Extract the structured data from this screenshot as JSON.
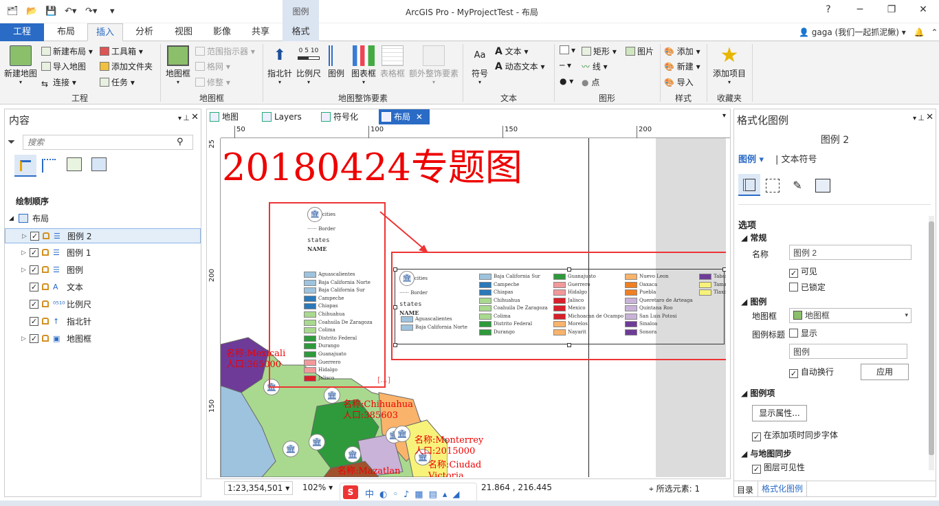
{
  "window": {
    "title": "ArcGIS Pro - MyProjectTest - 布局",
    "context_group": "图例",
    "help": "?",
    "user": "gaga (我们一起抓泥鳅)"
  },
  "tabs": [
    "工程",
    "布局",
    "插入",
    "分析",
    "视图",
    "影像",
    "共享",
    "格式"
  ],
  "ribbon": {
    "project": {
      "new_map": "新建地图",
      "new_layout": "新建布局",
      "import_map": "导入地图",
      "connect": "连接",
      "toolbox": "工具箱",
      "add_folder": "添加文件夹",
      "task": "任务",
      "group": "工程"
    },
    "mapframe": {
      "map_frame": "地图框",
      "extent_indicator": "范围指示器",
      "grid": "格网",
      "modify": "修整",
      "group": "地图框"
    },
    "surround": {
      "north_arrow": "指北针",
      "scale_bar": "比例尺",
      "legend": "图例",
      "chart_frame": "图表框",
      "table_frame": "表格框",
      "extra": "额外整饰要素",
      "group": "地图整饰要素"
    },
    "text": {
      "symbol": "符号",
      "text": "文本",
      "dynamic_text": "动态文本",
      "group": "文本"
    },
    "graphics": {
      "rectangle": "矩形",
      "line": "线",
      "point": "点",
      "picture": "图片",
      "group": "图形"
    },
    "styles": {
      "add": "添加",
      "new": "新建",
      "import": "导入",
      "group": "样式"
    },
    "favorites": {
      "add_item": "添加项目",
      "group": "收藏夹"
    }
  },
  "contents": {
    "title": "内容",
    "search_placeholder": "搜索",
    "drawing_order": "绘制顺序",
    "root": "布局",
    "items": [
      "图例 2",
      "图例 1",
      "图例",
      "文本",
      "比例尺",
      "指北针",
      "地图框"
    ]
  },
  "doc_tabs": [
    "地图",
    "Layers",
    "符号化",
    "布局"
  ],
  "layout": {
    "title_text": "20180424专题图",
    "ruler_h": [
      "50",
      "100",
      "150",
      "200"
    ],
    "ruler_v": [
      "25",
      "200",
      "150"
    ],
    "labels": [
      {
        "name": "名称:Mexicali",
        "pop": "人口:365000"
      },
      {
        "name": "名称:Chihuahua",
        "pop": "人口:385603"
      },
      {
        "name": "名称:Monterrey",
        "pop": "人口:2015000"
      },
      {
        "name": "名称:Ciudad",
        "pop": "Victoria"
      },
      {
        "name": "名称:Mazatlan",
        "pop": ""
      }
    ],
    "legend1": {
      "cities": "cities",
      "border": "Border",
      "states": "states",
      "name": "NAME",
      "items": [
        "Aguascalientes",
        "Baja California Norte",
        "Baja California Sur",
        "Campeche",
        "Chiapas",
        "Chihuahua",
        "Coahuila De Zaragoza",
        "Colima",
        "Distrito Federal",
        "Durango",
        "Guanajuato",
        "Guerrero",
        "Hidalgo",
        "Jalisco"
      ],
      "colors": [
        "#9ec3de",
        "#9ec3de",
        "#9ec3de",
        "#2b79b8",
        "#2b79b8",
        "#a9d98e",
        "#a9d98e",
        "#a9d98e",
        "#2e9a3c",
        "#2e9a3c",
        "#2e9a3c",
        "#f2999a",
        "#f2999a",
        "#d7202a"
      ]
    },
    "legend2": {
      "cities": "cities",
      "border": "Border",
      "states": "states",
      "name": "NAME",
      "col0": [
        "Aguascalientes",
        "Baja California Norte"
      ],
      "col1": [
        "Baja California Sur",
        "Campeche",
        "Chiapas",
        "Chihuahua",
        "Coahuila De Zaragoza",
        "Colima",
        "Distrito Federal",
        "Durango"
      ],
      "col2": [
        "Guanajuato",
        "Guerrero",
        "Hidalgo",
        "Jalisco",
        "Mexico",
        "Michoacan de Ocampo",
        "Morelos",
        "Nayarit"
      ],
      "col3": [
        "Nuevo Leon",
        "Oaxaca",
        "Puebla",
        "Queretaro de Arteaga",
        "Quintana Roo",
        "San Luis Potosi",
        "Sinaloa",
        "Sonora"
      ],
      "col4": [
        "Tabasco",
        "Tamaulipas",
        "Tlaxcala"
      ],
      "c0": [
        "#9ec3de",
        "#9ec3de"
      ],
      "c1": [
        "#9ec3de",
        "#2b79b8",
        "#2b79b8",
        "#a9d98e",
        "#a9d98e",
        "#a9d98e",
        "#2e9a3c",
        "#2e9a3c"
      ],
      "c2": [
        "#2e9a3c",
        "#f2999a",
        "#f2999a",
        "#d7202a",
        "#d7202a",
        "#d7202a",
        "#f9b36b",
        "#f9b36b"
      ],
      "c3": [
        "#f9b36b",
        "#f07f22",
        "#f07f22",
        "#c9b3d8",
        "#c9b3d8",
        "#c9b3d8",
        "#6e3b98",
        "#6e3b98"
      ],
      "c4": [
        "#6e3b98",
        "#f7f27a",
        "#f7f27a"
      ]
    }
  },
  "status": {
    "scale": "1:23,354,501",
    "zoom": "102%",
    "coords": "21.864 , 216.445",
    "selected": "所选元素: 1"
  },
  "format_pane": {
    "title": "格式化图例",
    "element": "图例 2",
    "tab_legend": "图例",
    "tab_text_symbol": "文本符号",
    "options": "选项",
    "general": "常规",
    "name_label": "名称",
    "name_value": "图例 2",
    "visible": "可见",
    "locked": "已锁定",
    "legend_section": "图例",
    "map_frame_label": "地图框",
    "map_frame_value": "地图框",
    "legend_title_label": "图例标题",
    "show": "显示",
    "title_value": "图例",
    "auto_wrap": "自动换行",
    "apply": "应用",
    "legend_items": "图例项",
    "show_props": "显示属性...",
    "sync_font": "在添加项时同步字体",
    "map_sync": "与地图同步",
    "layer_visibility": "图层可见性",
    "bottom_tab_catalog": "目录",
    "bottom_tab_format": "格式化图例"
  }
}
